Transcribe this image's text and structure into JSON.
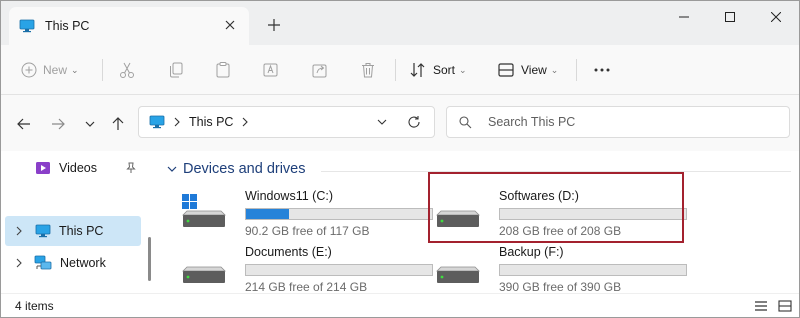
{
  "tab": {
    "title": "This PC"
  },
  "toolbar": {
    "new_label": "New",
    "sort_label": "Sort",
    "view_label": "View"
  },
  "address": {
    "location": "This PC"
  },
  "search": {
    "placeholder": "Search This PC"
  },
  "sidebar": {
    "items": [
      {
        "label": "Videos"
      },
      {
        "label": "This PC"
      },
      {
        "label": "Network"
      }
    ]
  },
  "main": {
    "group_title": "Devices and drives",
    "drives": [
      {
        "name": "Windows11 (C:)",
        "free_text": "90.2 GB free of 117 GB",
        "used_fraction": 0.23
      },
      {
        "name": "Softwares (D:)",
        "free_text": "208 GB free of 208 GB",
        "used_fraction": 0.0
      },
      {
        "name": "Documents (E:)",
        "free_text": "214 GB free of 214 GB",
        "used_fraction": 0.0
      },
      {
        "name": "Backup (F:)",
        "free_text": "390 GB free of 390 GB",
        "used_fraction": 0.0
      }
    ]
  },
  "status": {
    "item_count": "4 items"
  },
  "colors": {
    "accent": "#2683d9",
    "selection": "#cde6f7",
    "highlight": "#a3212e",
    "group_header": "#1e3f7a"
  },
  "icons": [
    "monitor-icon",
    "close-icon",
    "plus-icon",
    "minimize-icon",
    "maximize-icon",
    "cut-icon",
    "copy-icon",
    "paste-icon",
    "rename-icon",
    "share-icon",
    "delete-icon",
    "sort-icon",
    "view-icon",
    "more-icon",
    "back-icon",
    "forward-icon",
    "up-icon",
    "refresh-icon",
    "search-icon",
    "video-icon",
    "pin-icon",
    "network-icon",
    "drive-icon",
    "windows-logo-icon"
  ]
}
